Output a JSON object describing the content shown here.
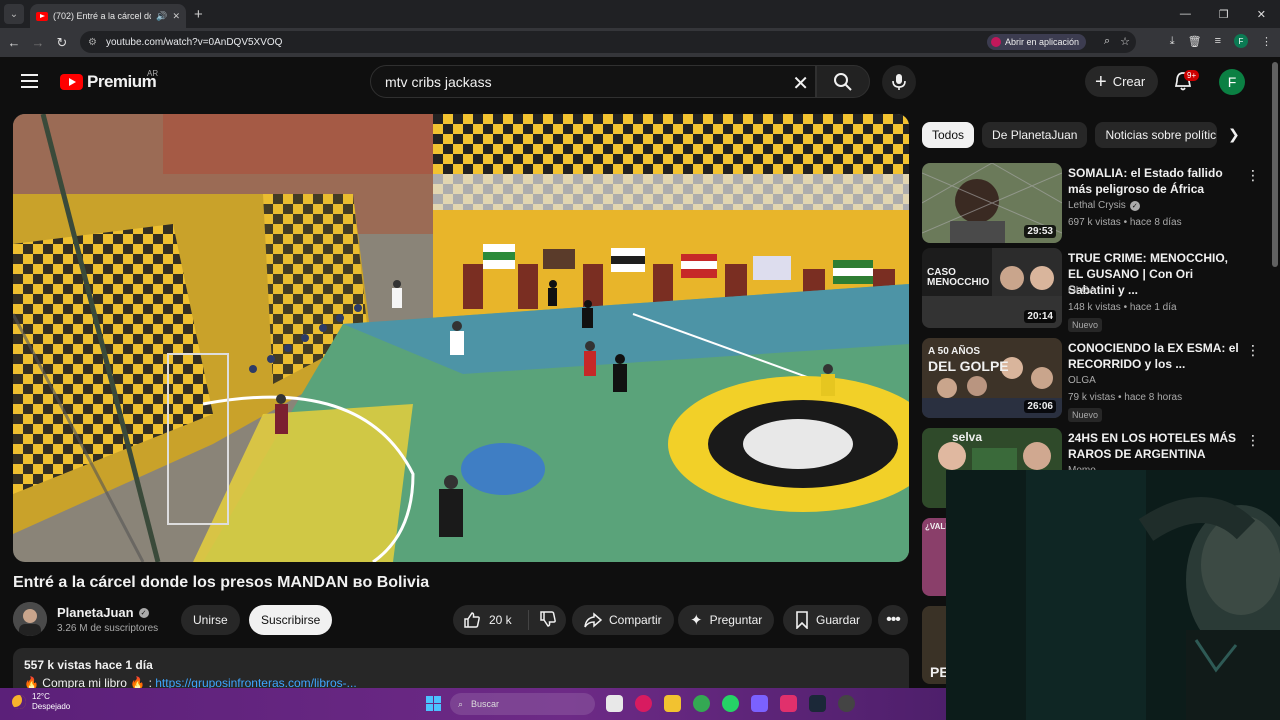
{
  "browser": {
    "tab_title": "(702) Entré a la cárcel donde",
    "url": "youtube.com/watch?v=0AnDQV5XVOQ",
    "open_in_app": "Abrir en aplicación",
    "profile_initial": "F"
  },
  "header": {
    "logo_text": "Premium",
    "region": "AR",
    "search_value": "mtv cribs jackass",
    "create_label": "Crear",
    "notif_badge": "9+",
    "avatar_initial": "F"
  },
  "video": {
    "title": "Entré a la cárcel donde los presos MANDAN ʙᴏ Bolivia",
    "channel": "PlanetaJuan",
    "subscribers": "3.26 M de suscriptores",
    "join_label": "Unirse",
    "subscribe_label": "Suscribirse",
    "likes": "20 k",
    "share_label": "Compartir",
    "ask_label": "Preguntar",
    "save_label": "Guardar",
    "views_line": "557 k vistas  hace 1 día",
    "desc_prefix": "🔥 Compra mi libro 🔥 : ",
    "desc_link": "https://gruposinfronteras.com/libros-..."
  },
  "sidebar": {
    "chips": [
      "Todos",
      "De PlanetaJuan",
      "Noticias sobre polític"
    ],
    "recs": [
      {
        "title": "SOMALIA: el Estado fallido más peligroso de África",
        "channel": "Lethal Crysis",
        "verified": true,
        "meta": "697 k vistas • hace 8 días",
        "duration": "29:53",
        "new": ""
      },
      {
        "title": "TRUE CRIME: MENOCCHIO, EL GUSANO | Con Ori Sabatini y ...",
        "channel": "OLGA",
        "verified": false,
        "meta": "148 k vistas • hace 1 día",
        "duration": "20:14",
        "new": "Nuevo"
      },
      {
        "title": "CONOCIENDO la EX ESMA: el RECORRIDO y los ...",
        "channel": "OLGA",
        "verified": false,
        "meta": "79 k vistas • hace 8 horas",
        "duration": "26:06",
        "new": "Nuevo"
      },
      {
        "title": "24HS EN LOS HOTELES MÁS RAROS DE ARGENTINA",
        "channel": "Momo",
        "verified": true,
        "meta": "",
        "duration": "",
        "new": ""
      }
    ],
    "thumb_texts": {
      "t2": "CASO MENOCCHIO",
      "t3a": "A 50 AÑOS",
      "t3b": "DEL GOLPE",
      "t4": "selva",
      "t5": "¿VALE",
      "t6": "PE"
    }
  },
  "taskbar": {
    "temp": "12°C",
    "weather": "Despejado",
    "search": "Buscar"
  },
  "colors": {
    "accent": "#ff0000",
    "link": "#3ea6ff",
    "bg": "#0f0f0f"
  }
}
